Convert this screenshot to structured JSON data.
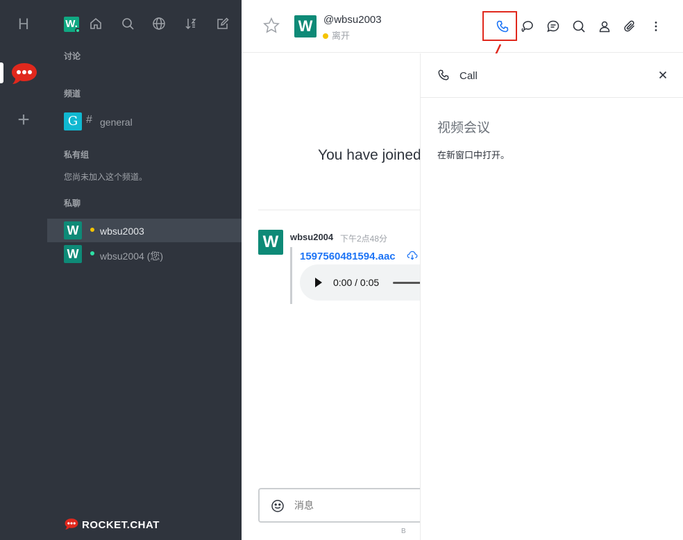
{
  "rail": {
    "home_letter": "H"
  },
  "sidebar": {
    "user_avatar_letter": "W.",
    "sections": {
      "discussions": "讨论",
      "channels": "频道",
      "private_groups": "私有组",
      "private_groups_empty": "您尚未加入这个频道。",
      "direct_messages": "私聊"
    },
    "channels": [
      {
        "avatar": "G",
        "label": "general",
        "color": "#10b8d1"
      }
    ],
    "direct_messages": [
      {
        "avatar": "W",
        "label": "wbsu2003",
        "status_color": "#f5c400",
        "avatar_color": "#0e8a77"
      },
      {
        "avatar": "W",
        "label": "wbsu2004 (您)",
        "status_color": "#2de0a5",
        "avatar_color": "#0e8a77"
      }
    ],
    "brand": "ROCKET.CHAT"
  },
  "header": {
    "avatar": "W",
    "username": "@wbsu2003",
    "status": "离开",
    "status_color": "#f5c400"
  },
  "messages": {
    "joined_text": "You have joined",
    "author_avatar": "W",
    "author": "wbsu2004",
    "time": "下午2点48分",
    "attachment_name": "1597560481594.aac",
    "audio_time": "0:00 / 0:05"
  },
  "composer": {
    "placeholder": "消息",
    "hint": "B"
  },
  "call_panel": {
    "title": "Call",
    "video_title": "视频会议",
    "open_new_window": "在新窗口中打开。"
  },
  "colors": {
    "accent": "#1d74f5",
    "highlight": "#e0281d",
    "sidebar_bg": "#2f343d"
  }
}
